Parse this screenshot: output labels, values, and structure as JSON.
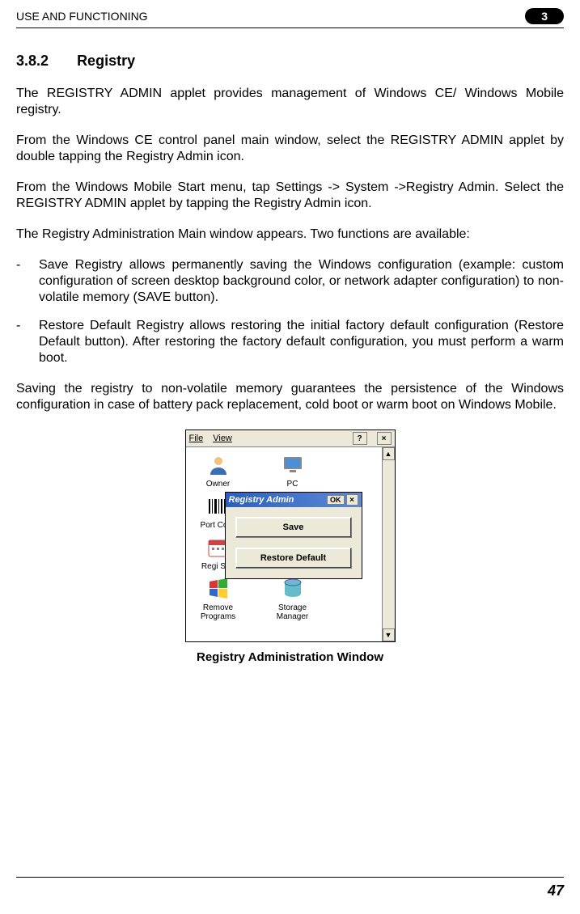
{
  "header": {
    "title": "USE AND FUNCTIONING",
    "chapter": "3"
  },
  "section": {
    "number": "3.8.2",
    "title": "Registry"
  },
  "paragraphs": {
    "p1": "The REGISTRY ADMIN applet provides management of Windows CE/ Windows Mobile registry.",
    "p2": "From the Windows CE control panel main window, select the REGISTRY ADMIN applet by double tapping the Registry Admin icon.",
    "p3": "From the Windows Mobile Start menu, tap Settings -> System ->Registry Admin. Select the REGISTRY ADMIN applet by tapping the Registry Admin icon.",
    "p4": "The Registry Administration Main window appears. Two functions are available:",
    "p5": "Saving the registry to non-volatile memory guarantees the persistence of the Windows configuration in case of battery pack replacement, cold boot or warm boot on Windows Mobile."
  },
  "bullets": {
    "b1": "Save Registry allows permanently saving the Windows configuration (example: custom configuration of screen desktop background color, or network adapter configuration) to non-volatile memory (SAVE button).",
    "b2": "Restore Default Registry allows restoring the initial factory default configuration (Restore Default button). After restoring the factory default configuration, you must perform a warm boot."
  },
  "ce_window": {
    "menu": {
      "file": "File",
      "view": "View",
      "help": "?",
      "close": "×"
    },
    "icons": {
      "owner": "Owner",
      "pc": "PC",
      "port_colle": "Port Colle",
      "regi_sett": "Regi Sett",
      "remove_programs": "Remove Programs",
      "storage_manager": "Storage Manager"
    },
    "scroll": {
      "up": "▲",
      "down": "▼"
    },
    "dialog": {
      "title": "Registry Admin",
      "ok": "OK",
      "close": "×",
      "save": "Save",
      "restore": "Restore Default"
    }
  },
  "caption": "Registry Administration Window",
  "page_number": "47"
}
